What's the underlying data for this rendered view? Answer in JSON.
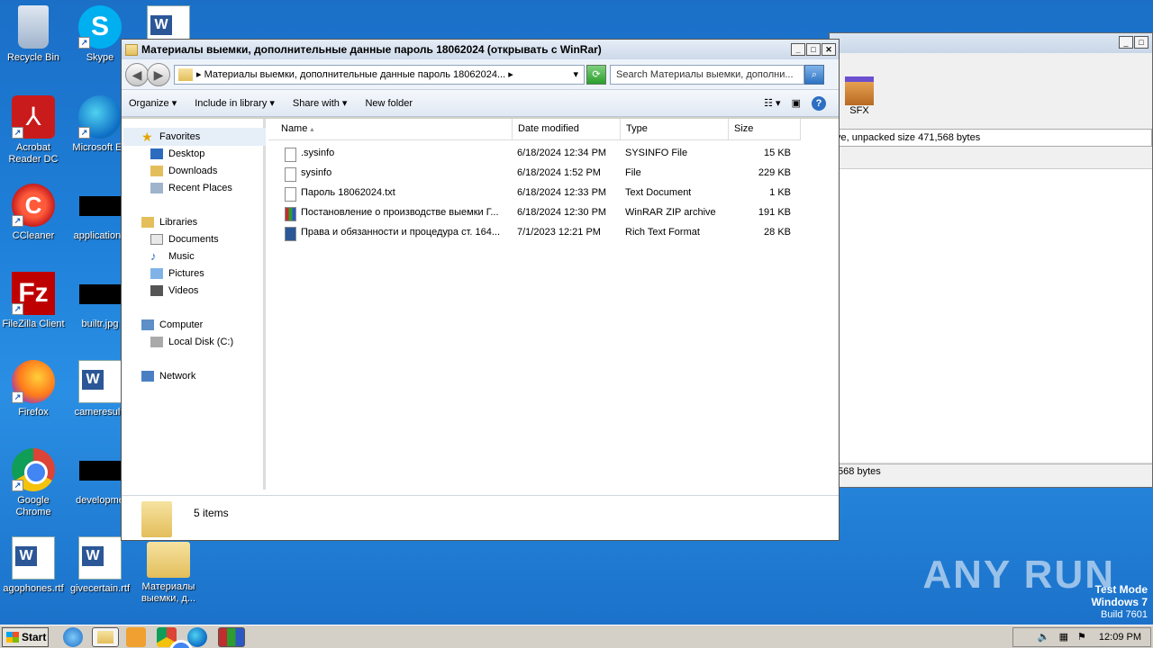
{
  "desktop": {
    "icons": [
      {
        "label": "Recycle Bin"
      },
      {
        "label": "Skype"
      },
      {
        "label": "Acrobat Reader DC"
      },
      {
        "label": "Microsoft Ed"
      },
      {
        "label": "CCleaner"
      },
      {
        "label": "applicatione"
      },
      {
        "label": "FileZilla Client"
      },
      {
        "label": "builtr.jpg"
      },
      {
        "label": "Firefox"
      },
      {
        "label": "cameresult."
      },
      {
        "label": "Google Chrome"
      },
      {
        "label": "developme"
      },
      {
        "label": "agophones.rtf"
      },
      {
        "label": "givecertain.rtf"
      },
      {
        "label": "Материалы выемки, д..."
      }
    ]
  },
  "bgwinrar": {
    "sfx_label": "SFX",
    "info": "ve, unpacked size 471,568 bytes",
    "status": ",568 bytes"
  },
  "explorer": {
    "title": "Материалы выемки, дополнительные данные  пароль 18062024 (открывать с WinRar)",
    "address": "▸ Материалы выемки, дополнительные данные  пароль 18062024... ▸",
    "search_placeholder": "Search Материалы выемки, дополни...",
    "toolbar": {
      "organize": "Organize ▾",
      "include": "Include in library ▾",
      "share": "Share with ▾",
      "new_folder": "New folder"
    },
    "nav": {
      "favorites": "Favorites",
      "desktop": "Desktop",
      "downloads": "Downloads",
      "recent": "Recent Places",
      "libraries": "Libraries",
      "documents": "Documents",
      "music": "Music",
      "pictures": "Pictures",
      "videos": "Videos",
      "computer": "Computer",
      "local_disk": "Local Disk (C:)",
      "network": "Network"
    },
    "columns": {
      "name": "Name",
      "date": "Date modified",
      "type": "Type",
      "size": "Size"
    },
    "files": [
      {
        "name": ".sysinfo",
        "date": "6/18/2024 12:34 PM",
        "type": "SYSINFO File",
        "size": "15 KB",
        "icon": "file-icon"
      },
      {
        "name": "sysinfo",
        "date": "6/18/2024 1:52 PM",
        "type": "File",
        "size": "229 KB",
        "icon": "file-icon"
      },
      {
        "name": "Пароль 18062024.txt",
        "date": "6/18/2024 12:33 PM",
        "type": "Text Document",
        "size": "1 KB",
        "icon": "text-file-icon"
      },
      {
        "name": "Постановление о производстве выемки Г...",
        "date": "6/18/2024 12:30 PM",
        "type": "WinRAR ZIP archive",
        "size": "191 KB",
        "icon": "winrar-archive-icon"
      },
      {
        "name": "Права и обязанности и процедура ст. 164...",
        "date": "7/1/2023 12:21 PM",
        "type": "Rich Text Format",
        "size": "28 KB",
        "icon": "word-document-icon"
      }
    ],
    "item_count": "5 items"
  },
  "watermark": "ANY RUN",
  "testmode": {
    "line1": "Test Mode",
    "line2": "Windows 7",
    "line3": "Build 7601"
  },
  "taskbar": {
    "start": "Start",
    "clock": "12:09 PM"
  }
}
